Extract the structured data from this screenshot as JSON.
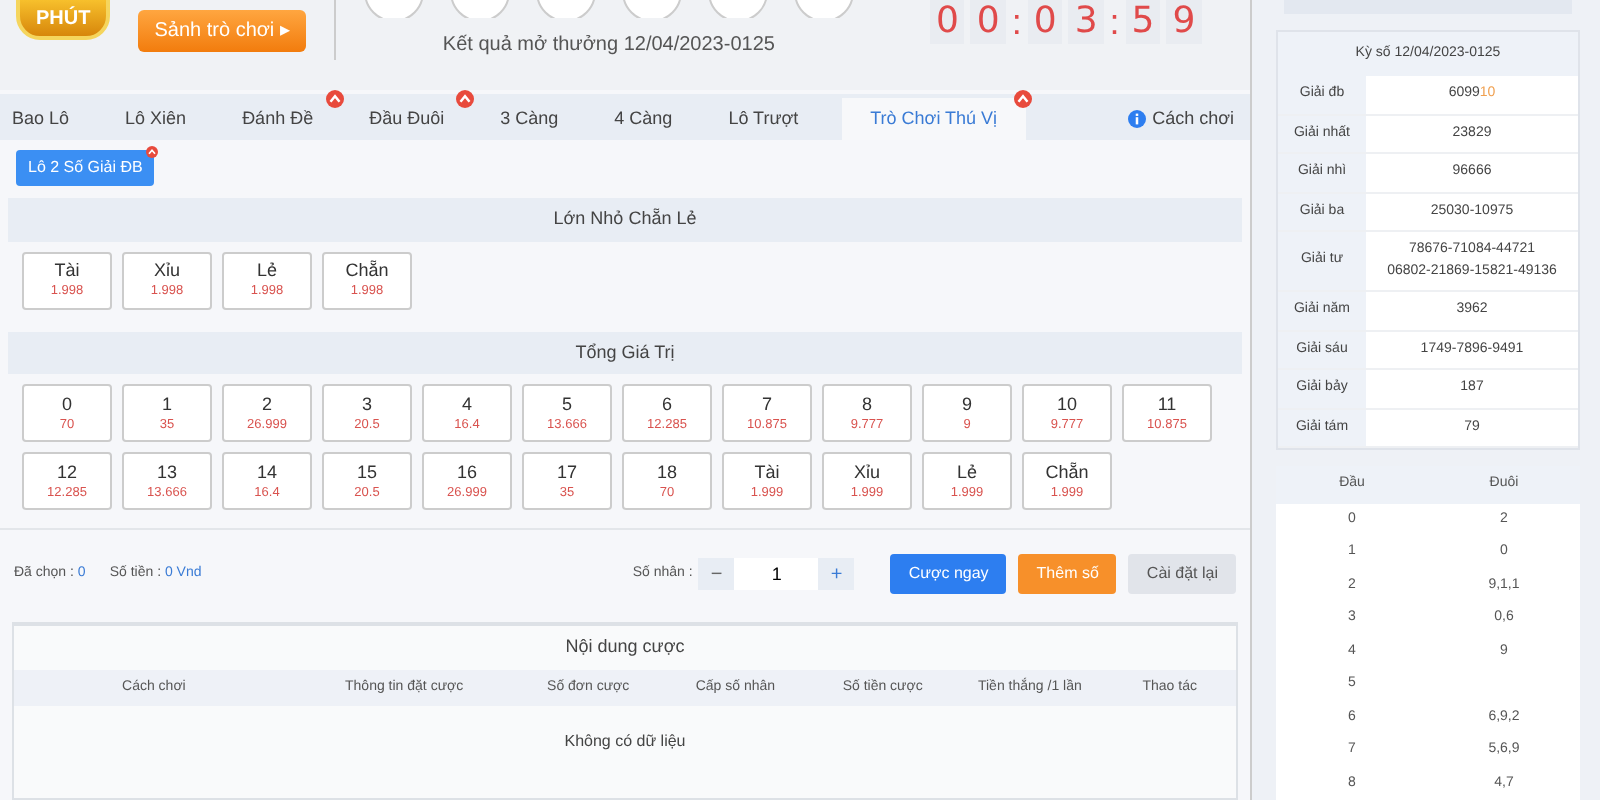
{
  "header": {
    "logo_text": "PHÚT",
    "lobby_button": "Sảnh trò chơi ▸",
    "result_caption": "Kết quả mở thưởng 12/04/2023-0125",
    "countdown": [
      "0",
      "0",
      ":",
      "0",
      "3",
      ":",
      "5",
      "9"
    ]
  },
  "tabs": [
    {
      "label": "Bao Lô",
      "selected": false,
      "hot": false
    },
    {
      "label": "Lô Xiên",
      "selected": false,
      "hot": false
    },
    {
      "label": "Đánh Đề",
      "selected": false,
      "hot": true
    },
    {
      "label": "Đầu Đuôi",
      "selected": false,
      "hot": true
    },
    {
      "label": "3 Càng",
      "selected": false,
      "hot": false
    },
    {
      "label": "4 Càng",
      "selected": false,
      "hot": false
    },
    {
      "label": "Lô Trượt",
      "selected": false,
      "hot": false
    },
    {
      "label": "Trò Chơi Thú Vị",
      "selected": true,
      "hot": true
    }
  ],
  "how_to_play": "Cách chơi",
  "sub_tabs": [
    {
      "label": "Lô 2 Số Giải ĐB",
      "selected": true,
      "hot": true
    }
  ],
  "sections": [
    {
      "title": "Lớn Nhỏ Chẵn Lẻ",
      "options": [
        {
          "label": "Tài",
          "odds": "1.998"
        },
        {
          "label": "Xỉu",
          "odds": "1.998"
        },
        {
          "label": "Lẻ",
          "odds": "1.998"
        },
        {
          "label": "Chẵn",
          "odds": "1.998"
        }
      ]
    },
    {
      "title": "Tổng Giá Trị",
      "options": [
        {
          "label": "0",
          "odds": "70"
        },
        {
          "label": "1",
          "odds": "35"
        },
        {
          "label": "2",
          "odds": "26.999"
        },
        {
          "label": "3",
          "odds": "20.5"
        },
        {
          "label": "4",
          "odds": "16.4"
        },
        {
          "label": "5",
          "odds": "13.666"
        },
        {
          "label": "6",
          "odds": "12.285"
        },
        {
          "label": "7",
          "odds": "10.875"
        },
        {
          "label": "8",
          "odds": "9.777"
        },
        {
          "label": "9",
          "odds": "9"
        },
        {
          "label": "10",
          "odds": "9.777"
        },
        {
          "label": "11",
          "odds": "10.875"
        },
        {
          "label": "12",
          "odds": "12.285"
        },
        {
          "label": "13",
          "odds": "13.666"
        },
        {
          "label": "14",
          "odds": "16.4"
        },
        {
          "label": "15",
          "odds": "20.5"
        },
        {
          "label": "16",
          "odds": "26.999"
        },
        {
          "label": "17",
          "odds": "35"
        },
        {
          "label": "18",
          "odds": "70"
        },
        {
          "label": "Tài",
          "odds": "1.999"
        },
        {
          "label": "Xỉu",
          "odds": "1.999"
        },
        {
          "label": "Lẻ",
          "odds": "1.999"
        },
        {
          "label": "Chẵn",
          "odds": "1.999"
        }
      ]
    }
  ],
  "summary": {
    "selected_label": "Đã chọn :",
    "selected_value": "0",
    "amount_label": "Số tiền :",
    "amount_value": "0 Vnd"
  },
  "multiplier": {
    "label": "Số nhân :",
    "minus": "−",
    "value": "1",
    "plus": "+"
  },
  "actions": [
    {
      "label": "Cược ngay",
      "kind": "primary"
    },
    {
      "label": "Thêm số",
      "kind": "warning"
    },
    {
      "label": "Cài đặt lại",
      "kind": "light"
    }
  ],
  "bet_table": {
    "title": "Nội dung cược",
    "columns": [
      "Cách chơi",
      "Thông tin đặt cược",
      "Số đơn cược",
      "Cấp số nhân",
      "Số tiền cược",
      "Tiền thắng /1 lần",
      "Thao tác"
    ],
    "empty": "Không có dữ liệu"
  },
  "results": {
    "title": "Kỳ số 12/04/2023-0125",
    "rows": [
      {
        "prize": "Giải đb",
        "numbers": [
          "6099"
        ],
        "highlight_tail": "10"
      },
      {
        "prize": "Giải nhất",
        "numbers": [
          "23829"
        ]
      },
      {
        "prize": "Giải nhì",
        "numbers": [
          "96666"
        ]
      },
      {
        "prize": "Giải ba",
        "numbers": [
          "25030-10975"
        ]
      },
      {
        "prize": "Giải tư",
        "numbers": [
          "78676-71084-44721",
          "06802-21869-15821-49136"
        ]
      },
      {
        "prize": "Giải năm",
        "numbers": [
          "3962"
        ]
      },
      {
        "prize": "Giải sáu",
        "numbers": [
          "1749-7896-9491"
        ]
      },
      {
        "prize": "Giải bảy",
        "numbers": [
          "187"
        ]
      },
      {
        "prize": "Giải tám",
        "numbers": [
          "79"
        ]
      }
    ]
  },
  "head_tail": {
    "columns": [
      "Đầu",
      "Đuôi"
    ],
    "rows": [
      [
        "0",
        "2"
      ],
      [
        "1",
        "0"
      ],
      [
        "2",
        "9,1,1"
      ],
      [
        "3",
        "0,6"
      ],
      [
        "4",
        "9"
      ],
      [
        "5",
        ""
      ],
      [
        "6",
        "6,9,2"
      ],
      [
        "7",
        "5,6,9"
      ],
      [
        "8",
        "4,7"
      ]
    ]
  }
}
